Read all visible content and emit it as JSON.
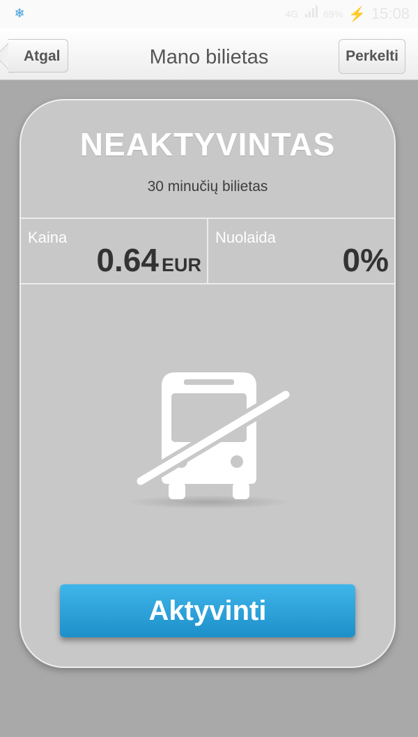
{
  "status_bar": {
    "app_icon": "snowflake-icon",
    "network": "4G",
    "battery": "69%",
    "time": "15:08",
    "charging_icon": "lightning-icon"
  },
  "nav": {
    "back_label": "Atgal",
    "title": "Mano bilietas",
    "transfer_label": "Perkelti"
  },
  "ticket": {
    "status": "NEAKTYVINTAS",
    "type": "30 minučių bilietas",
    "price_label": "Kaina",
    "price_value": "0.64",
    "price_unit": "EUR",
    "discount_label": "Nuolaida",
    "discount_value": "0%",
    "graphic_icon": "bus-disabled-icon",
    "activate_label": "Aktyvinti"
  }
}
